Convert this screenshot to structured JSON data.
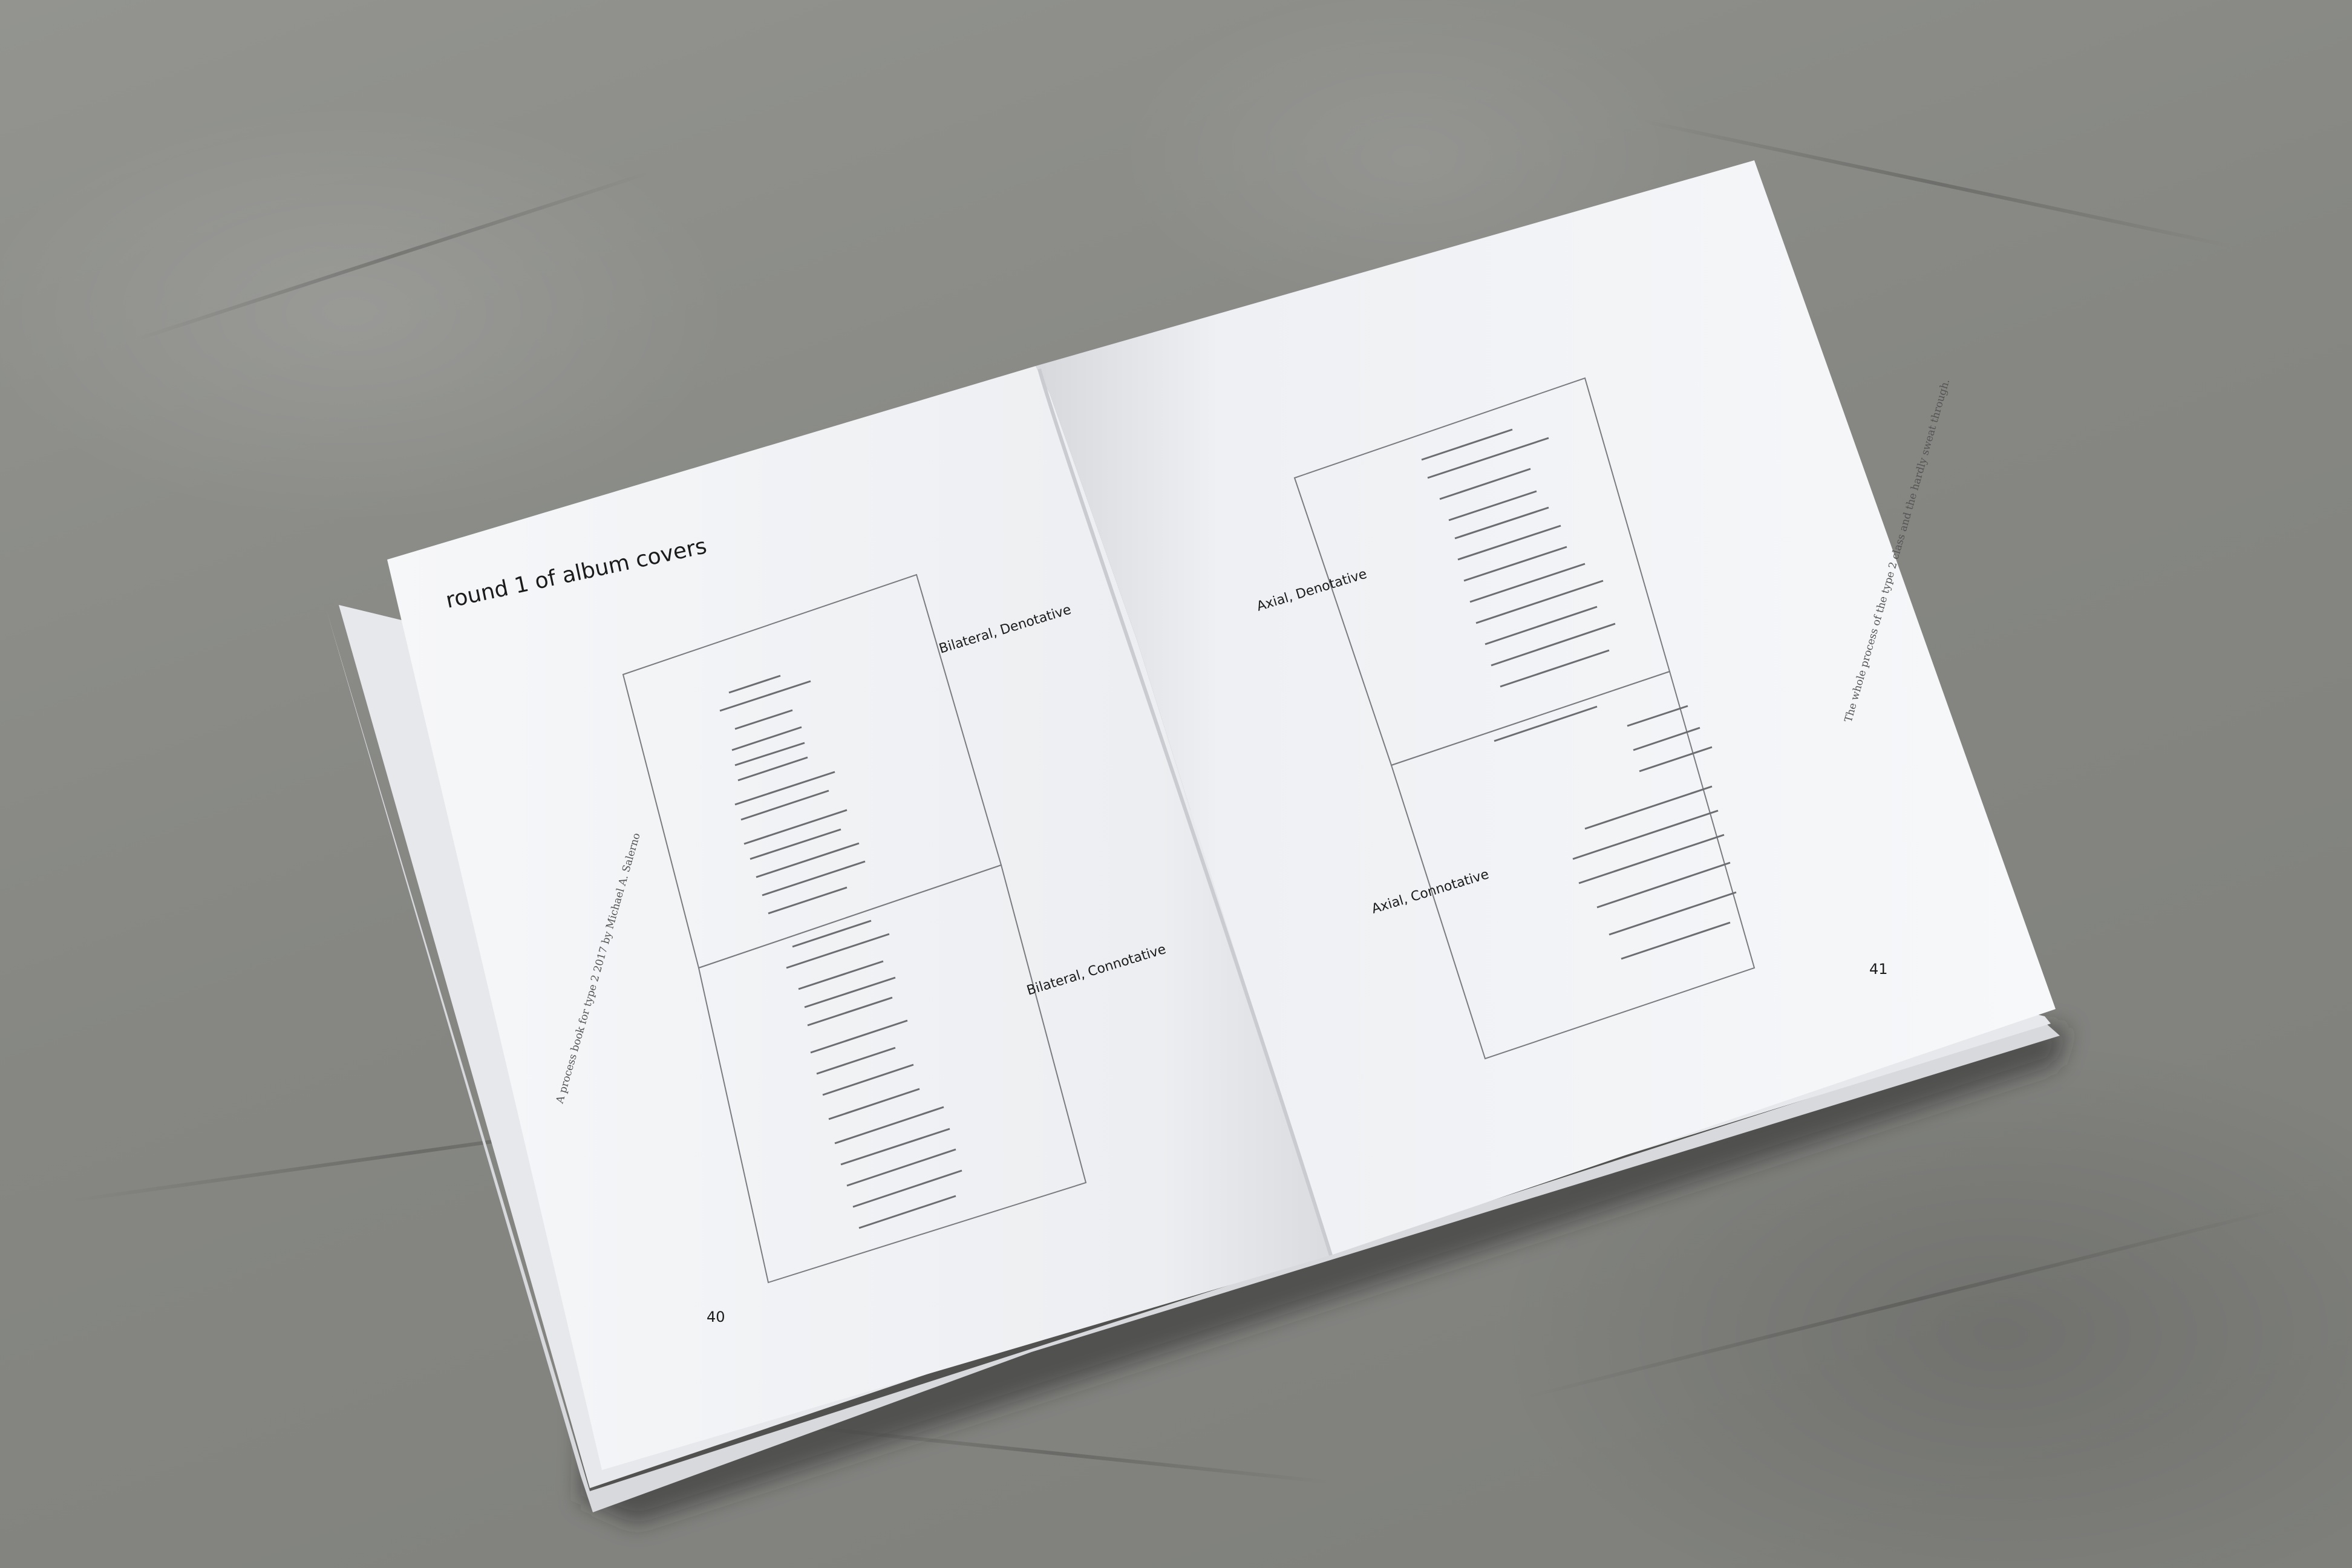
{
  "book": {
    "left_page": {
      "heading": "round 1 of album covers",
      "side_caption": "A process book for type 2 2017 by Michael A. Salerno",
      "label_top": "Bilateral, Denotative",
      "label_bottom": "Bilateral, Connotative",
      "page_number": "40"
    },
    "right_page": {
      "side_caption": "The whole process of the type 2 class and the hardly sweat through.",
      "label_top": "Axial, Denotative",
      "label_bottom": "Axial, Connotative",
      "page_number": "41"
    }
  },
  "colors": {
    "cloth": "#8a8b88",
    "paper": "#f4f5f7",
    "ink": "#1b1b1b"
  }
}
